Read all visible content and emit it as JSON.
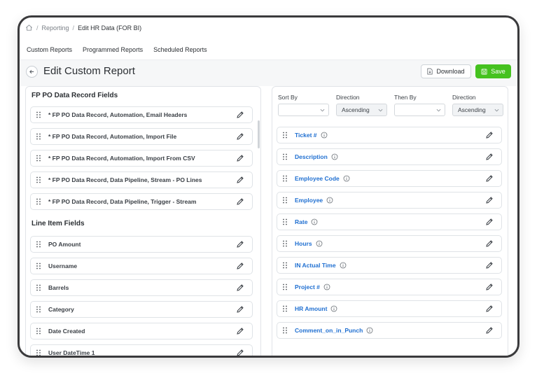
{
  "breadcrumb": {
    "items": [
      "Reporting",
      "Edit HR Data (FOR BI)"
    ],
    "separator": "/"
  },
  "tabs": [
    "Custom Reports",
    "Programmed Reports",
    "Scheduled Reports"
  ],
  "header": {
    "title": "Edit Custom Report",
    "download_label": "Download",
    "save_label": "Save"
  },
  "left": {
    "section1_title": "FP PO Data Record Fields",
    "section1_items": [
      "* FP PO Data Record, Automation, Email Headers",
      "* FP PO Data Record, Automation, Import File",
      "* FP PO Data Record, Automation, Import From CSV",
      "* FP PO Data Record, Data Pipeline, Stream - PO Lines",
      "* FP PO Data Record, Data Pipeline, Trigger - Stream"
    ],
    "section2_title": "Line Item Fields",
    "section2_items": [
      "PO Amount",
      "Username",
      "Barrels",
      "Category",
      "Date Created",
      "User DateTime 1"
    ]
  },
  "right": {
    "sort": {
      "sort_by_label": "Sort By",
      "direction_label": "Direction",
      "then_by_label": "Then By",
      "direction2_label": "Direction",
      "sort_by_value": "",
      "direction_value": "Ascending",
      "then_by_value": "",
      "direction2_value": "Ascending"
    },
    "fields": [
      "Ticket #",
      "Description",
      "Employee Code",
      "Employee",
      "Rate",
      "Hours",
      "IN Actual Time",
      "Project #",
      "HR Amount",
      "Comment_on_in_Punch"
    ]
  },
  "colors": {
    "accent_blue": "#1f6fd1",
    "save_green": "#45c21f",
    "header_bg": "#f6f7f8"
  }
}
